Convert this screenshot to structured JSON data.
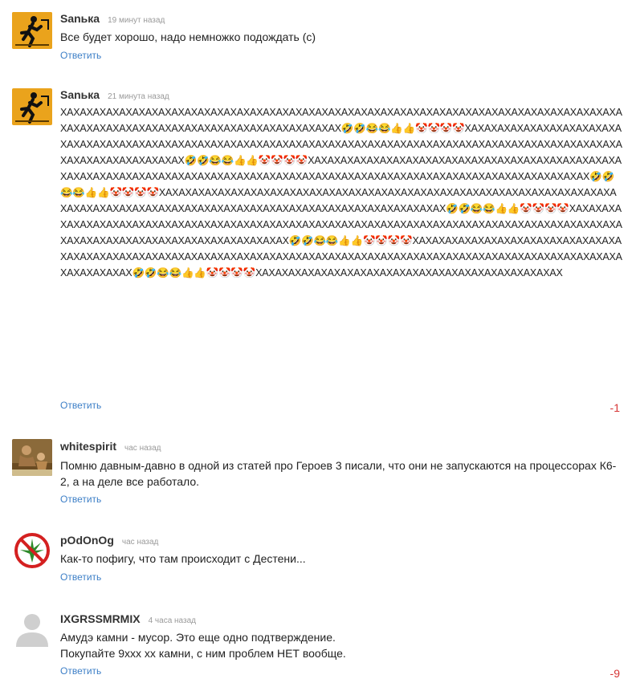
{
  "reply_label": "Ответить",
  "comments": [
    {
      "author": "Sanька",
      "time": "19 минут назад",
      "text": "Все будет хорошо, надо немножко подождать (с)"
    },
    {
      "author": "Sanька",
      "time": "21 минута назад",
      "text": "ХАХАХАХАХАХАХАХАХАХАХАХАХАХАХАХАХАХАХАХАХАХАХАХАХАХАХАХАХАХАХАХАХАХАХАХАХАХАХАХАХАХАХАХАХАХАХАХАХАХАХАХАХАХАХАХАХАХАХАХАХАХАХАХАХ🤣🤣😂😂👍👍🤡🤡🤡🤡ХАХАХАХАХАХАХАХАХАХАХАХАХАХАХАХАХАХАХАХАХАХАХАХАХАХАХАХАХАХАХАХАХАХАХАХАХАХАХАХАХАХАХАХАХАХАХАХАХАХАХАХАХАХАХАХАХАХАХАХАХАХАХАХАХ🤣🤣😂😂👍👍🤡🤡🤡🤡ХАХАХАХАХАХАХАХАХАХАХАХАХАХАХАХАХАХАХАХАХАХАХАХАХАХАХАХАХАХАХАХАХАХАХАХАХАХАХАХАХАХАХАХАХАХАХАХАХАХАХАХАХАХАХАХАХАХАХАХАХАХАХАХАХ🤣🤣😂😂👍👍🤡🤡🤡🤡ХАХАХАХАХАХАХАХАХАХАХАХАХАХАХАХАХАХАХАХАХАХАХАХАХАХАХАХАХАХАХАХАХАХАХАХАХАХАХАХАХАХАХАХАХАХАХАХАХАХАХАХАХАХАХАХАХАХАХАХАХАХАХАХАХ🤣🤣😂😂👍👍🤡🤡🤡🤡ХАХАХАХАХАХАХАХАХАХАХАХАХАХАХАХАХАХАХАХАХАХАХАХАХАХАХАХАХАХАХАХАХАХАХАХАХАХАХАХАХАХАХАХАХАХАХАХАХАХАХАХАХАХАХАХАХАХАХАХАХАХАХАХАХ🤣🤣😂😂👍👍🤡🤡🤡🤡ХАХАХАХАХАХАХАХАХАХАХАХАХАХАХАХАХАХАХАХАХАХАХАХАХАХАХАХАХАХАХАХАХАХАХАХАХАХАХАХАХАХАХАХАХАХАХАХАХАХАХАХАХАХАХАХАХАХАХАХАХАХАХАХАХ🤣🤣😂😂👍👍🤡🤡🤡🤡ХАХАХАХАХАХАХАХАХАХАХАХАХАХАХАХАХАХАХАХАХАХАХАХ",
      "score": "-1"
    },
    {
      "author": "whitespirit",
      "time": "час назад",
      "text": "Помню давным-давно в одной из статей про Героев 3 писали, что они не запускаются на процессорах К6-2, а на деле все работало."
    },
    {
      "author": "pOdOnOg",
      "time": "час назад",
      "text": "Как-то пофигу, что там происходит с Дестени..."
    },
    {
      "author": "IXGRSSMRMIX",
      "time": "4 часа назад",
      "text_line1": "Амудэ камни - мусор. Это еще одно подтверждение.",
      "text_line2": "Покупайте 9ххх хх камни, с ним проблем НЕТ вообще.",
      "score": "-9"
    }
  ],
  "colors": {
    "link": "#3d7fc7",
    "negative": "#d63535",
    "time": "#9a9a9a"
  },
  "icons": [
    "runner-avatar",
    "painting-avatar",
    "leaf-prohibited-avatar",
    "default-user-avatar"
  ]
}
